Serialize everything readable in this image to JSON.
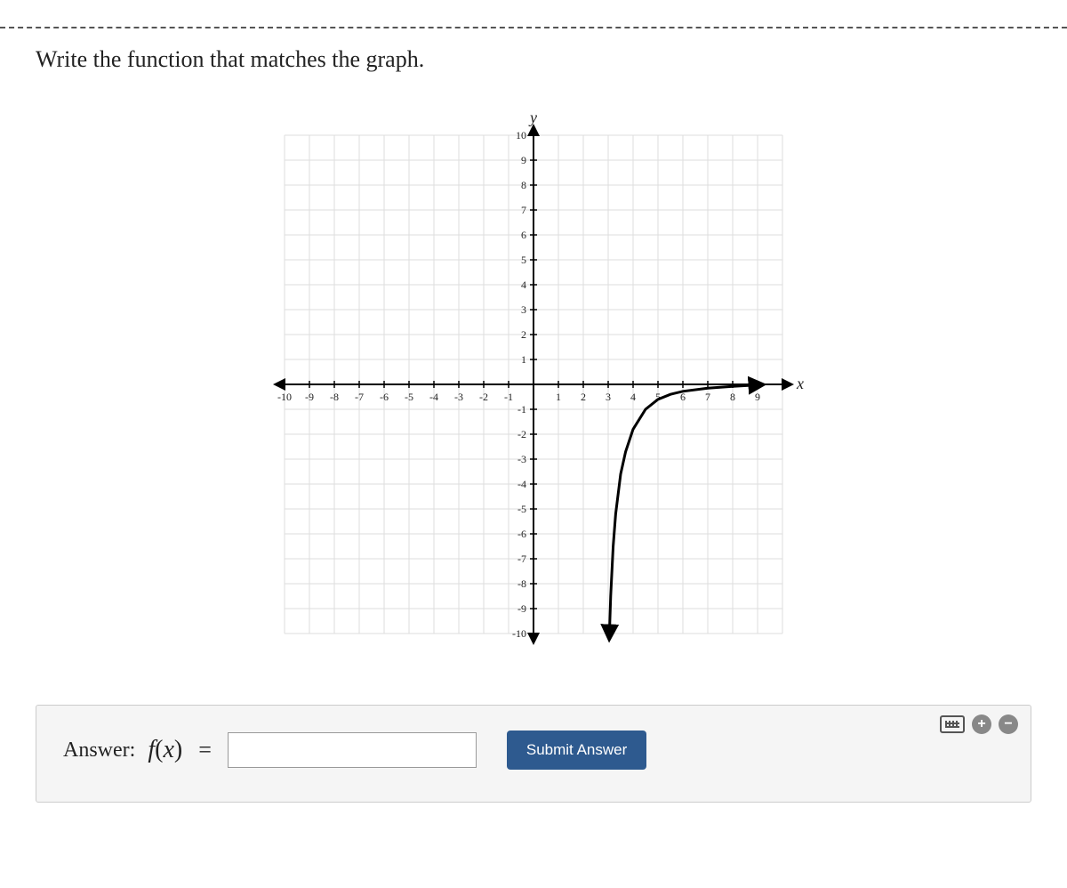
{
  "prompt": "Write the function that matches the graph.",
  "answer_section": {
    "label": "Answer:",
    "func_prefix_html": "f(x) =",
    "input_value": "",
    "submit_label": "Submit Answer"
  },
  "chart_data": {
    "type": "line",
    "title": "",
    "xlabel": "x",
    "ylabel": "y",
    "xlim": [
      -10,
      10
    ],
    "ylim": [
      -10,
      10
    ],
    "xticks": [
      -10,
      -9,
      -8,
      -7,
      -6,
      -5,
      -4,
      -3,
      -2,
      -1,
      1,
      2,
      3,
      4,
      5,
      6,
      7,
      8,
      9
    ],
    "yticks": [
      -10,
      -9,
      -8,
      -7,
      -6,
      -5,
      -4,
      -3,
      -2,
      -1,
      1,
      2,
      3,
      4,
      5,
      6,
      7,
      8,
      9,
      10
    ],
    "description": "Curve resembling a logarithmic function with a vertical asymptote near x = 3, passing through approximately (4, -1) and approaching y ≈ 0 as x increases toward 9. For x just greater than 3 the curve goes to −∞.",
    "series": [
      {
        "name": "f(x)",
        "x": [
          3.05,
          3.1,
          3.2,
          3.3,
          3.5,
          3.7,
          4,
          4.5,
          5,
          5.5,
          6,
          7,
          8,
          9
        ],
        "y": [
          -10,
          -8.5,
          -6.5,
          -5.2,
          -3.6,
          -2.7,
          -1.8,
          -1.0,
          -0.6,
          -0.4,
          -0.28,
          -0.15,
          -0.08,
          -0.02
        ]
      }
    ]
  }
}
